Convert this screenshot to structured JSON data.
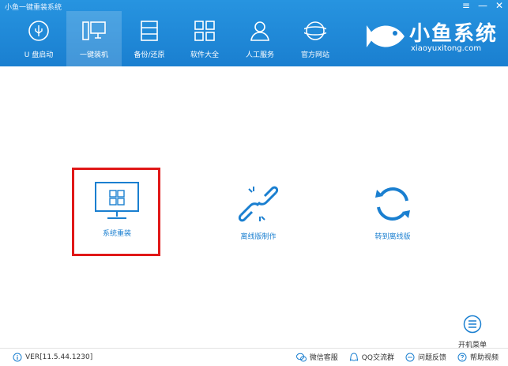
{
  "window": {
    "title": "小鱼一键重装系统",
    "controls": {
      "menu": "≡",
      "minimize": "—",
      "close": "✕"
    }
  },
  "nav": {
    "items": [
      {
        "label": "U 盘启动",
        "icon": "usb-icon"
      },
      {
        "label": "一键装机",
        "icon": "desktop-icon",
        "active": true
      },
      {
        "label": "备份/还原",
        "icon": "backup-icon"
      },
      {
        "label": "软件大全",
        "icon": "apps-grid-icon"
      },
      {
        "label": "人工服务",
        "icon": "support-person-icon"
      },
      {
        "label": "官方网站",
        "icon": "globe-icon"
      }
    ]
  },
  "brand": {
    "name": "小鱼系统",
    "url": "xiaoyuxitong.com"
  },
  "actions": [
    {
      "label": "系统重装",
      "icon": "monitor-windows-icon",
      "selected": true
    },
    {
      "label": "离线版制作",
      "icon": "broken-link-icon"
    },
    {
      "label": "转到离线版",
      "icon": "refresh-icon"
    }
  ],
  "boot_menu": {
    "label": "开机菜单",
    "icon": "list-menu-icon"
  },
  "footer": {
    "version": "VER[11.5.44.1230]",
    "links": [
      {
        "label": "微信客服",
        "icon": "wechat-icon"
      },
      {
        "label": "QQ交流群",
        "icon": "qq-icon"
      },
      {
        "label": "问题反馈",
        "icon": "chat-bubble-icon"
      },
      {
        "label": "帮助视频",
        "icon": "help-icon"
      }
    ]
  },
  "colors": {
    "header": "#1a7fd0",
    "accent": "#1a7fd0",
    "highlight_border": "#e01818"
  }
}
